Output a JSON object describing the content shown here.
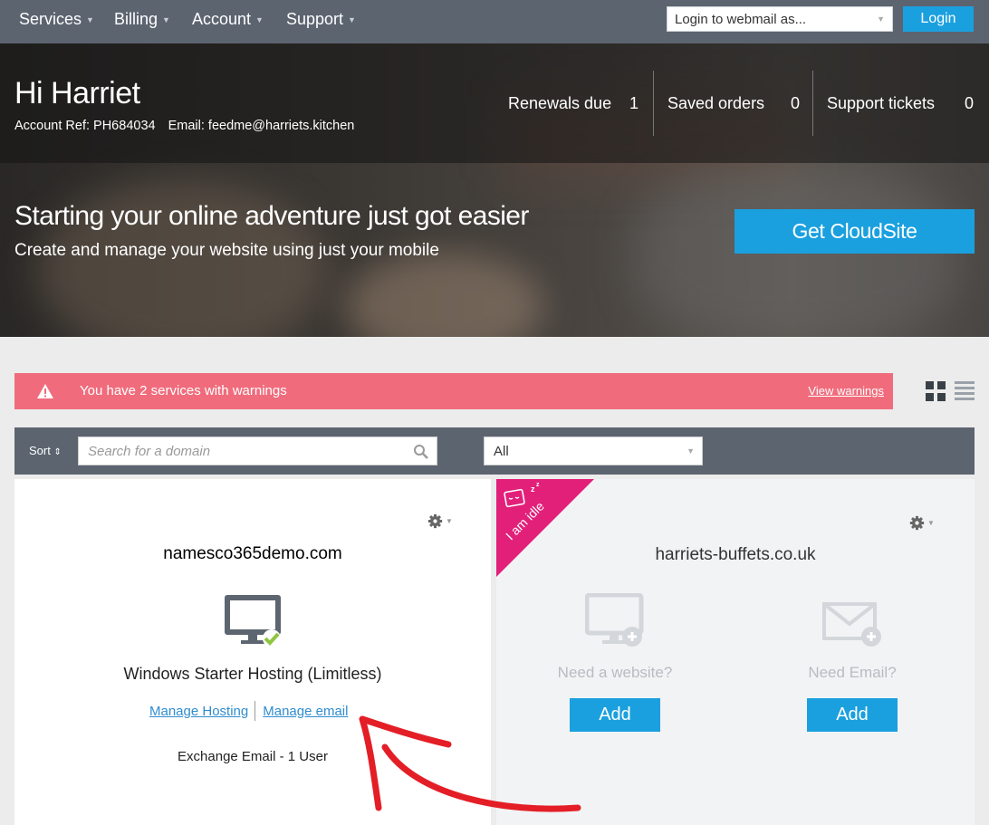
{
  "nav": {
    "items": [
      {
        "label": "Services"
      },
      {
        "label": "Billing"
      },
      {
        "label": "Account"
      },
      {
        "label": "Support"
      }
    ],
    "webmail_placeholder": "Login to webmail as...",
    "login_label": "Login"
  },
  "hero": {
    "greeting": "Hi Harriet",
    "account_ref": "Account Ref: PH684034",
    "email": "Email: feedme@harriets.kitchen",
    "stats": [
      {
        "label": "Renewals due",
        "value": "1"
      },
      {
        "label": "Saved orders",
        "value": "0"
      },
      {
        "label": "Support tickets",
        "value": "0"
      }
    ],
    "promo_title": "Starting your online adventure just got easier",
    "promo_sub": "Create and manage your website using just your mobile",
    "cta_label": "Get CloudSite"
  },
  "warning": {
    "text": "You have 2 services with warnings",
    "link": "View warnings"
  },
  "filters": {
    "sort_label": "Sort",
    "search_placeholder": "Search for a domain",
    "filter_value": "All"
  },
  "cards": [
    {
      "domain": "namesco365demo.com",
      "plan": "Windows Starter Hosting (Limitless)",
      "link_hosting": "Manage Hosting",
      "link_email": "Manage email",
      "email_plan": "Exchange Email - 1 User"
    },
    {
      "domain": "harriets-buffets.co.uk",
      "ribbon": "I am idle",
      "need_website": "Need a website?",
      "need_email": "Need Email?",
      "add_label": "Add"
    }
  ],
  "colors": {
    "accent": "#1aa0df",
    "nav_bg": "#5c6470",
    "warning_bg": "#f06c7c",
    "ribbon": "#e2207a"
  }
}
